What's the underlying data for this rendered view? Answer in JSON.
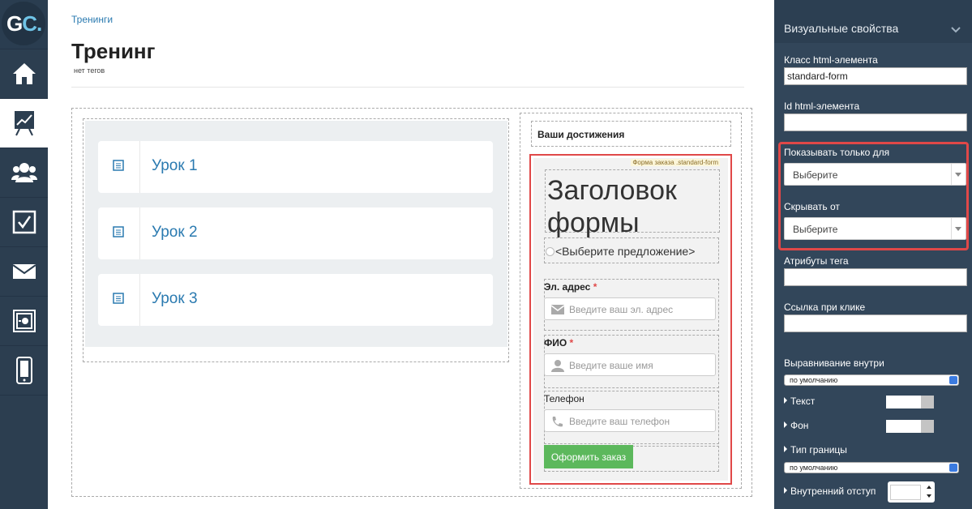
{
  "logo": {
    "g": "G",
    "c": "C."
  },
  "nav": [
    "home-icon",
    "chart-icon",
    "users-icon",
    "checkbox-icon",
    "mail-icon",
    "safe-icon",
    "mobile-icon"
  ],
  "breadcrumb": "Тренинги",
  "page": {
    "title": "Тренинг",
    "tags": "нет тегов"
  },
  "lessons": [
    "Урок 1",
    "Урок 2",
    "Урок 3"
  ],
  "achievements_title": "Ваши достижения",
  "form": {
    "tag": "Форма заказа .standard-form",
    "heading": "Заголовок формы",
    "offer": "<Выберите предложение>",
    "email_label": "Эл. адрес",
    "email_placeholder": "Введите ваш эл. адрес",
    "name_label": "ФИО",
    "name_placeholder": "Введите ваше имя",
    "phone_label": "Телефон",
    "phone_placeholder": "Введите ваш телефон",
    "required_mark": "*",
    "submit": "Оформить заказ"
  },
  "panel": {
    "title": "Визуальные свойства",
    "class_label": "Класс html-элемента",
    "class_value": "standard-form",
    "id_label": "Id html-элемента",
    "id_value": "",
    "show_only_label": "Показывать только для",
    "show_only_value": "Выберите",
    "hide_from_label": "Скрывать от",
    "hide_from_value": "Выберите",
    "attrs_label": "Атрибуты тега",
    "attrs_value": "",
    "link_label": "Ссылка при клике",
    "link_value": "",
    "align_label": "Выравнивание внутри",
    "align_value": "по умолчанию",
    "text_label": "Текст",
    "bg_label": "Фон",
    "border_label": "Тип границы",
    "border_value": "по умолчанию",
    "padding_label": "Внутренний отступ"
  },
  "colors": {
    "accent": "#2a7ab0",
    "sidebar": "#2c3e50",
    "panel": "#32465a",
    "highlight": "#e04848",
    "button": "#5cb85c"
  }
}
